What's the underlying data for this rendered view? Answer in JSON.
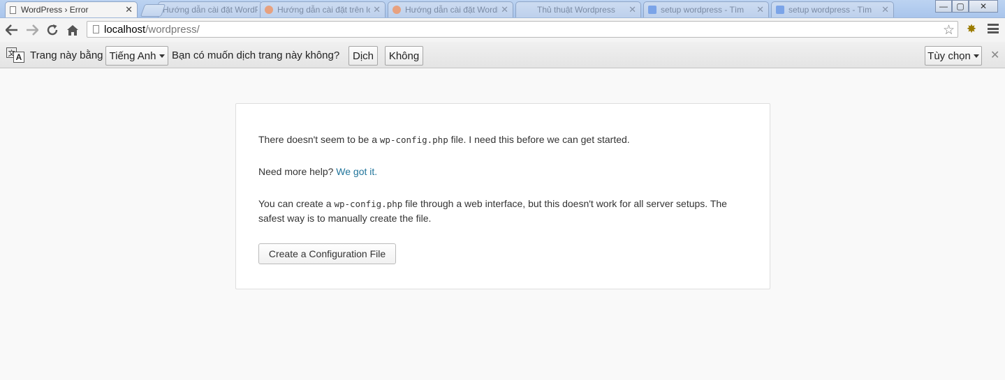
{
  "browser": {
    "tabs": [
      {
        "title": "WordPress › Error",
        "active": true
      },
      {
        "title": "Hướng dẫn cài đặt WordPress",
        "active": false
      },
      {
        "title": "Hướng dẫn cài đặt trên localhost",
        "active": false
      },
      {
        "title": "Hướng dẫn cài đặt WordPress",
        "active": false
      },
      {
        "title": "Thủ thuật Wordpress",
        "active": false
      },
      {
        "title": "setup wordpress - Tìm",
        "active": false
      },
      {
        "title": "setup wordpress - Tìm",
        "active": false
      }
    ],
    "tab_close": "✕",
    "window_controls": {
      "minimize": "—",
      "maximize": "▢",
      "close": "✕"
    },
    "url_host": "localhost",
    "url_path": "/wordpress/",
    "icons": {
      "back": "back-arrow-icon",
      "forward": "forward-arrow-icon",
      "reload": "reload-icon",
      "home": "home-icon",
      "bookmark": "star-icon",
      "extension": "extension-icon",
      "menu": "hamburger-menu-icon"
    }
  },
  "translate_bar": {
    "prefix": "Trang này bằng",
    "language": "Tiếng Anh",
    "question": "Bạn có muốn dịch trang này không?",
    "translate_button": "Dịch",
    "no_button": "Không",
    "options_button": "Tùy chọn",
    "close": "✕"
  },
  "content": {
    "p1_before": "There doesn't seem to be a ",
    "p1_code": "wp-config.php",
    "p1_after": " file. I need this before we can get started.",
    "p2_before": "Need more help? ",
    "p2_link": "We got it.",
    "p3_before": "You can create a ",
    "p3_code": "wp-config.php",
    "p3_after": " file through a web interface, but this doesn't work for all server setups. The safest way is to manually create the file.",
    "create_button": "Create a Configuration File"
  },
  "colors": {
    "link": "#21759b",
    "page_background": "#f9f9f9"
  }
}
